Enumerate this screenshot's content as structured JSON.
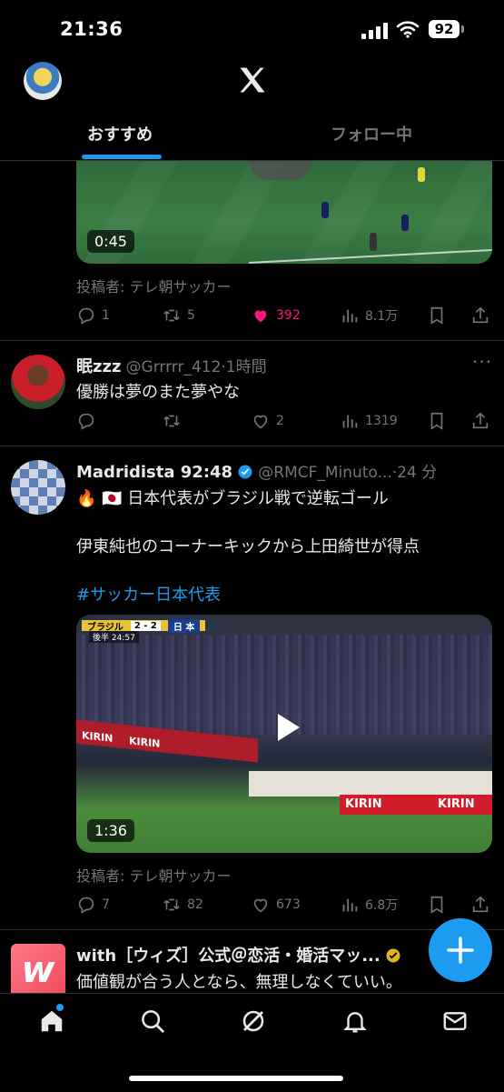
{
  "status_bar": {
    "time": "21:36",
    "battery": "92"
  },
  "header": {
    "tabs": [
      {
        "label": "おすすめ",
        "active": true
      },
      {
        "label": "フォロー中",
        "active": false
      }
    ]
  },
  "tweet1": {
    "duration": "0:45",
    "source": "投稿者: テレ朝サッカー",
    "replies": "1",
    "retweets": "5",
    "likes": "392",
    "views": "8.1万"
  },
  "tweet2": {
    "name": "眠zzz",
    "handle": "@Grrrrr_412",
    "time": "·1時間",
    "text": "優勝は夢のまた夢やな",
    "replies": "",
    "retweets": "",
    "likes": "2",
    "views": "1319"
  },
  "tweet3": {
    "name": "Madridista 92:48",
    "handle": "@RMCF_Minuto...",
    "time": "·24 分",
    "line1": "🔥 🇯🇵 日本代表がブラジル戦で逆転ゴール",
    "line2": "伊東純也のコーナーキックから上田綺世が得点",
    "hashtag": "#サッカー日本代表",
    "score_left": "ブラジル",
    "score": "2 - 2",
    "score_right": "日 本",
    "half": "後半",
    "clock": "24:57",
    "banner1": "KIRIN",
    "banner2": "KIRIN",
    "banner3": "KIRIN",
    "banner4": "KIRIN",
    "duration": "1:36",
    "source": "投稿者: テレ朝サッカー",
    "replies": "7",
    "retweets": "82",
    "likes": "673",
    "views": "6.8万"
  },
  "tweet4": {
    "name": "with［ウィズ］公式＠恋活・婚活マッ...",
    "text": "価値観が合う人となら、無理しなくていい。"
  },
  "colors": {
    "accent": "#1d9bf0",
    "like": "#f91880",
    "verified": "#1d9bf0",
    "gold": "#e2b719"
  }
}
